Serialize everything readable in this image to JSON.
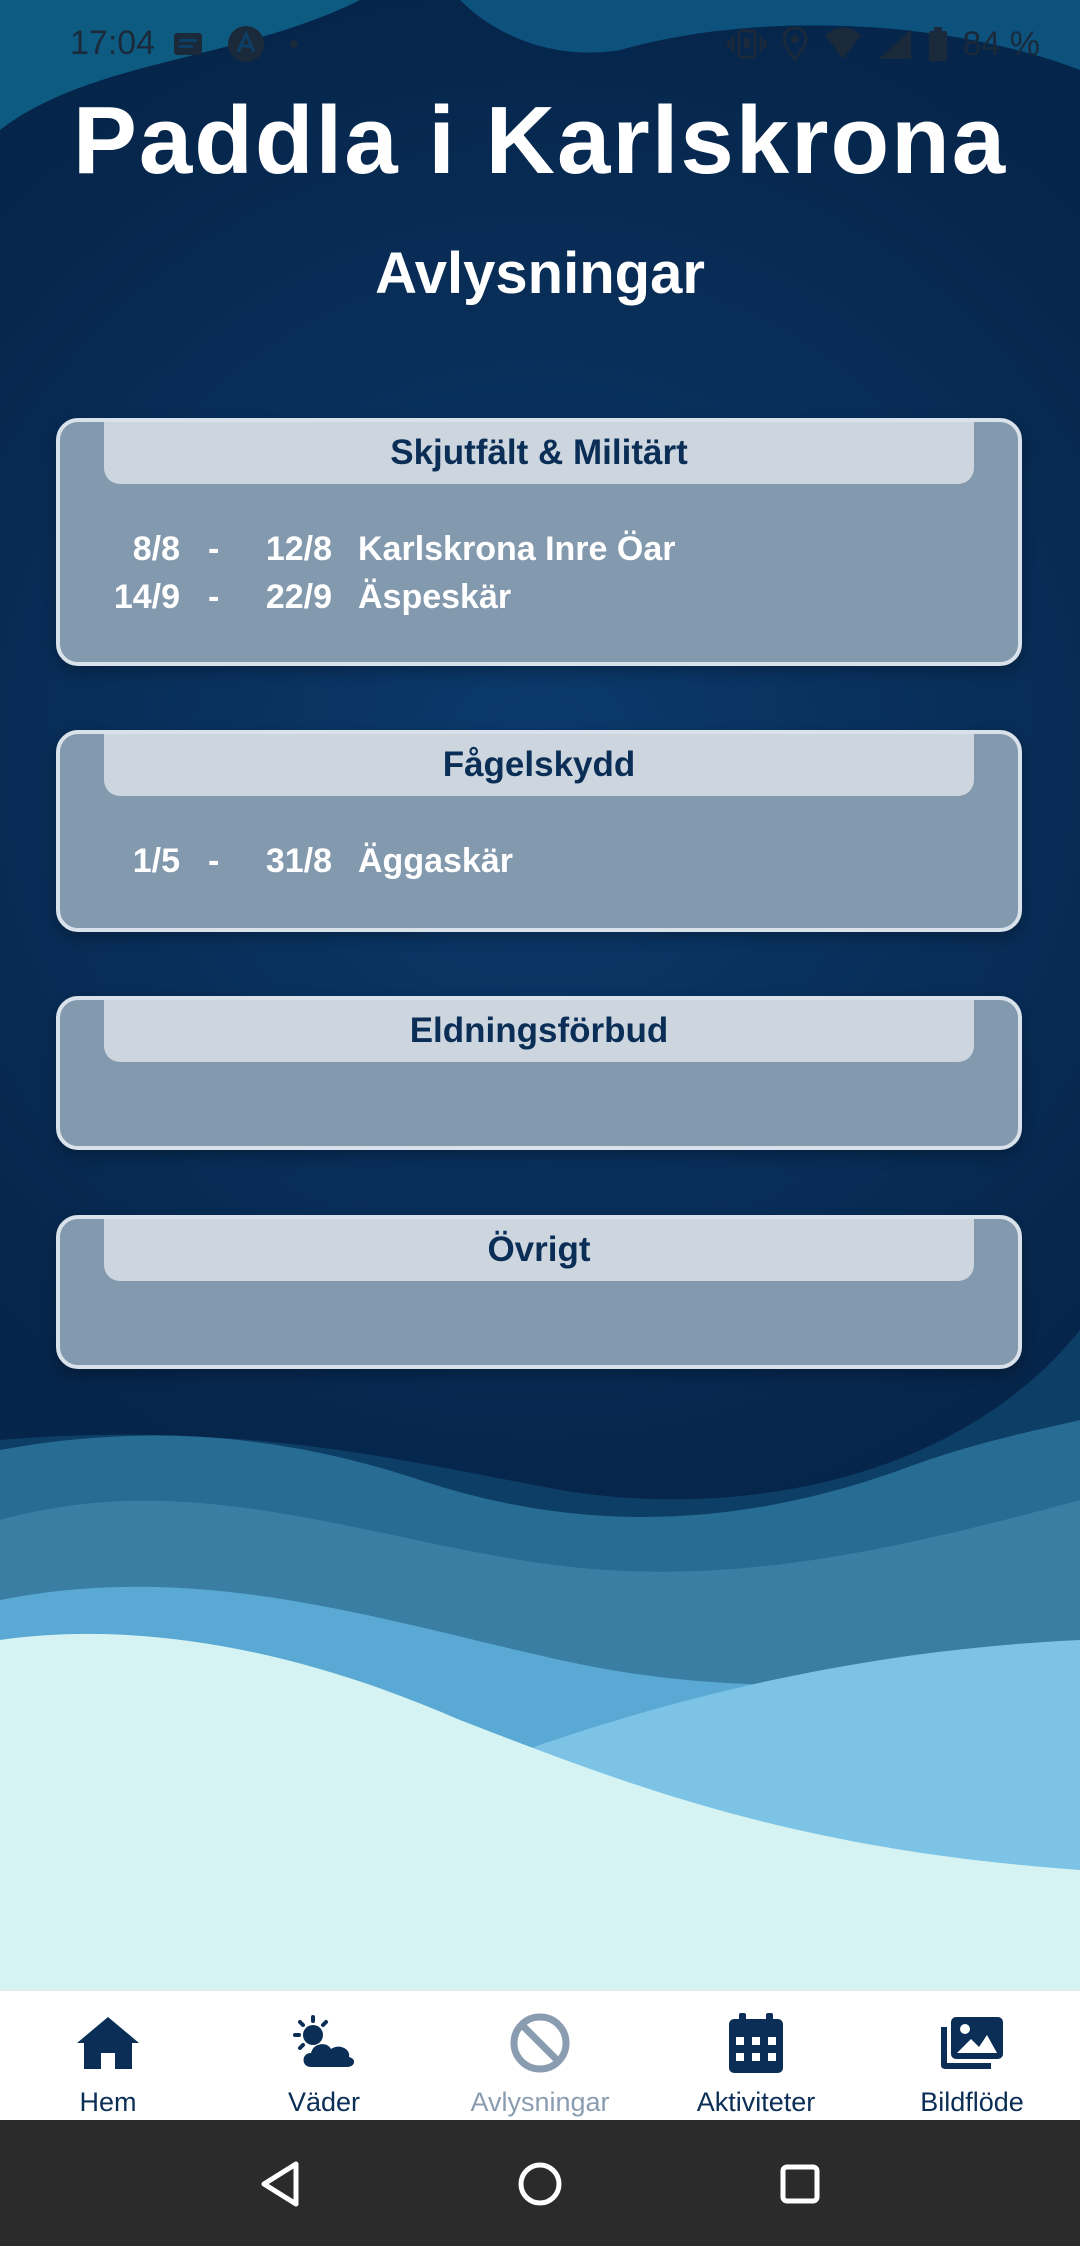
{
  "status_bar": {
    "time": "17:04",
    "battery": "84 %"
  },
  "header": {
    "app_title": "Paddla i Karlskrona",
    "page_title": "Avlysningar"
  },
  "cards": [
    {
      "title": "Skjutfält & Militärt",
      "rows": [
        {
          "from": "8/8",
          "sep": "-",
          "to": "12/8",
          "place": "Karlskrona Inre Öar"
        },
        {
          "from": "14/9",
          "sep": "-",
          "to": "22/9",
          "place": "Äspeskär"
        }
      ]
    },
    {
      "title": "Fågelskydd",
      "rows": [
        {
          "from": "1/5",
          "sep": "-",
          "to": "31/8",
          "place": "Äggaskär"
        }
      ]
    },
    {
      "title": "Eldningsförbud",
      "rows": []
    },
    {
      "title": "Övrigt",
      "rows": []
    }
  ],
  "nav": {
    "items": [
      {
        "label": "Hem",
        "icon": "home-icon"
      },
      {
        "label": "Väder",
        "icon": "weather-icon"
      },
      {
        "label": "Avlysningar",
        "icon": "ban-icon",
        "active": true
      },
      {
        "label": "Aktiviteter",
        "icon": "calendar-icon"
      },
      {
        "label": "Bildflöde",
        "icon": "images-icon"
      }
    ]
  },
  "colors": {
    "primary": "#0b2e56",
    "card_bg": "#8399ae",
    "card_header": "#cdd6df",
    "active_nav": "#8a9db0"
  }
}
